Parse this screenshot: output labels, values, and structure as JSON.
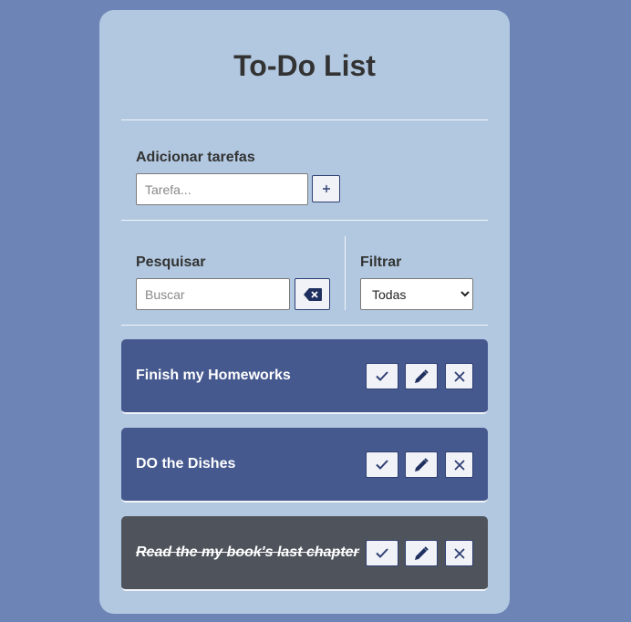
{
  "title": "To-Do List",
  "add": {
    "label": "Adicionar tarefas",
    "placeholder": "Tarefa...",
    "button_icon": "plus"
  },
  "search": {
    "label": "Pesquisar",
    "placeholder": "Buscar",
    "clear_icon": "backspace-icon"
  },
  "filter": {
    "label": "Filtrar",
    "selected": "Todas"
  },
  "tasks": [
    {
      "text": "Finish my Homeworks",
      "done": false
    },
    {
      "text": "DO the Dishes",
      "done": false
    },
    {
      "text": "Read the my book's last chapter",
      "done": true
    }
  ],
  "colors": {
    "background": "#6d84b6",
    "card": "#b2c8e0",
    "task": "#45598e",
    "task_done": "#4f545c",
    "accent": "#2f3f73"
  }
}
